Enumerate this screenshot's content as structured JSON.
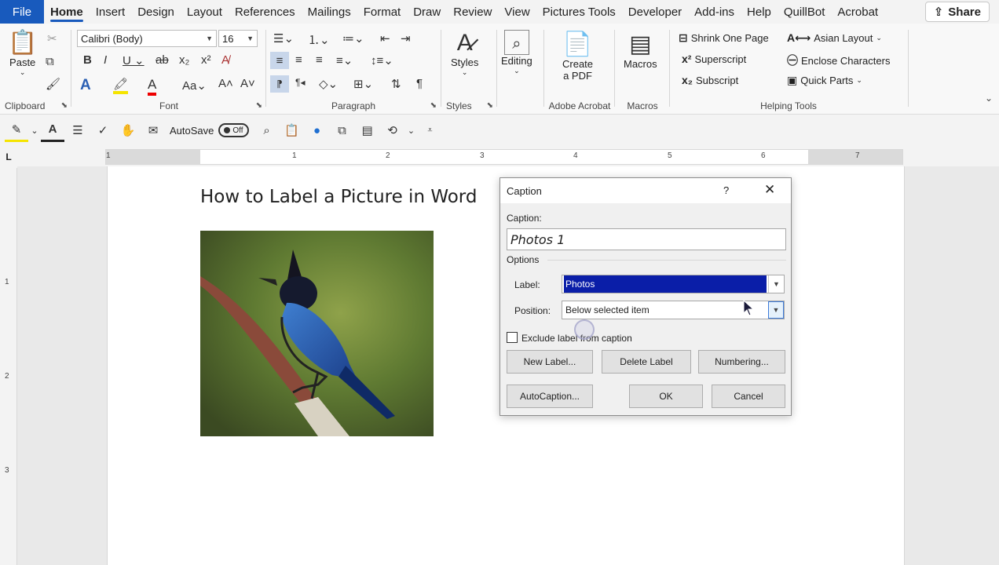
{
  "menubar": {
    "file": "File",
    "tabs": [
      "Home",
      "Insert",
      "Design",
      "Layout",
      "References",
      "Mailings",
      "Format",
      "Draw",
      "Review",
      "View",
      "Pictures Tools",
      "Developer",
      "Add-ins",
      "Help",
      "QuillBot",
      "Acrobat"
    ],
    "active_tab": "Home",
    "share": "Share"
  },
  "ribbon": {
    "clipboard": {
      "label": "Clipboard",
      "paste": "Paste"
    },
    "font": {
      "label": "Font",
      "font_name": "Calibri (Body)",
      "font_size": "16"
    },
    "paragraph": {
      "label": "Paragraph"
    },
    "styles": {
      "label": "Styles",
      "button": "Styles"
    },
    "editing": {
      "button": "Editing"
    },
    "adobe": {
      "label": "Adobe Acrobat",
      "create_pdf_line1": "Create",
      "create_pdf_line2": "a PDF"
    },
    "macros": {
      "label": "Macros",
      "button": "Macros"
    },
    "helping": {
      "label": "Helping Tools",
      "shrink": "Shrink One Page",
      "superscript": "Superscript",
      "subscript": "Subscript",
      "asian_layout": "Asian Layout",
      "enclose": "Enclose Characters",
      "quick_parts": "Quick Parts"
    }
  },
  "qat": {
    "autosave": "AutoSave",
    "toggle": "Off"
  },
  "ruler": {
    "numbers": [
      "1",
      "1",
      "2",
      "3",
      "4",
      "5",
      "6",
      "7"
    ],
    "vnumbers": [
      "1",
      "2",
      "3"
    ]
  },
  "document": {
    "heading": "How to Label a Picture in Word"
  },
  "dialog": {
    "title": "Caption",
    "help": "?",
    "close": "✕",
    "caption_label": "Caption:",
    "caption_value": "Photos 1",
    "options": "Options",
    "label_label": "Label:",
    "label_value": "Photos",
    "position_label": "Position:",
    "position_value": "Below selected item",
    "exclude": "Exclude label from caption",
    "new_label": "New Label...",
    "delete_label": "Delete Label",
    "numbering": "Numbering...",
    "autocaption": "AutoCaption...",
    "ok": "OK",
    "cancel": "Cancel"
  }
}
